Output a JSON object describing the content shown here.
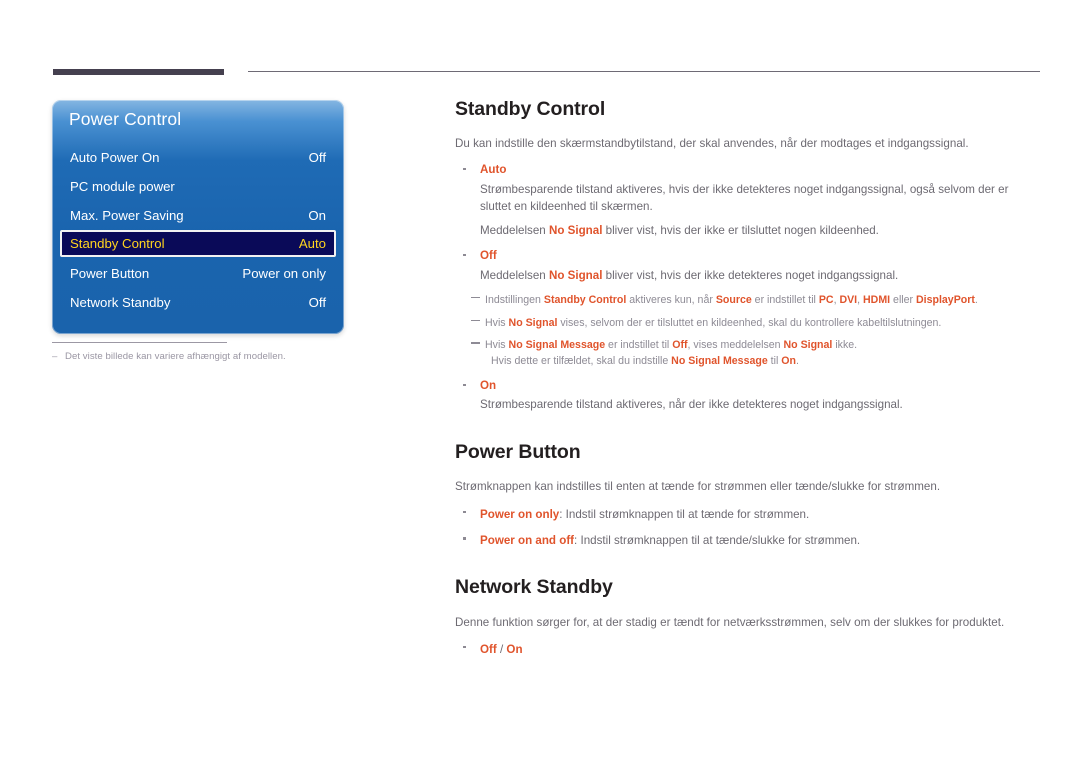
{
  "colors": {
    "accent": "#e0542c",
    "heading": "#231f20",
    "body": "#6d6a72",
    "note": "#8e8b95",
    "osd_selected_bg": "#0a0a58",
    "osd_selected_text": "#ffd41f",
    "top_bar": "#45404f"
  },
  "osd": {
    "title": "Power Control",
    "rows": [
      {
        "label": "Auto Power On",
        "value": "Off",
        "selected": false
      },
      {
        "label": "PC module power",
        "value": "",
        "selected": false
      },
      {
        "label": "Max. Power Saving",
        "value": "On",
        "selected": false
      },
      {
        "label": "Standby Control",
        "value": "Auto",
        "selected": true
      },
      {
        "label": "Power Button",
        "value": "Power on only",
        "selected": false
      },
      {
        "label": "Network Standby",
        "value": "Off",
        "selected": false
      }
    ],
    "footnote": "Det viste billede kan variere afhængigt af modellen.",
    "footnote_dash": "–"
  },
  "sections": {
    "standby_control": {
      "heading": "Standby Control",
      "lead": "Du kan indstille den skærmstandbytilstand, der skal anvendes, når der modtages et indgangssignal.",
      "items": [
        {
          "term": "Auto",
          "desc1": "Strømbesparende tilstand aktiveres, hvis der ikke detekteres noget indgangssignal, også selvom der er sluttet en kildeenhed til skærmen.",
          "desc2_pre": "Meddelelsen ",
          "desc2_b": "No Signal",
          "desc2_post": " bliver vist, hvis der ikke er tilsluttet nogen kildeenhed."
        },
        {
          "term": "Off",
          "desc1_pre": "Meddelelsen ",
          "desc1_b": "No Signal",
          "desc1_post": " bliver vist, hvis der ikke detekteres noget indgangssignal."
        },
        {
          "term": "On",
          "desc1": "Strømbesparende tilstand aktiveres, når der ikke detekteres noget indgangssignal."
        }
      ],
      "notes": [
        {
          "p1": "Indstillingen ",
          "b1": "Standby Control",
          "p2": " aktiveres kun, når ",
          "b2": "Source",
          "p3": " er indstillet til ",
          "b3": "PC",
          "p4": ", ",
          "b4": "DVI",
          "p5": ", ",
          "b5": "HDMI",
          "p6": " eller ",
          "b6": "DisplayPort",
          "p7": "."
        },
        {
          "p1": "Hvis ",
          "b1": "No Signal",
          "p2": " vises, selvom der er tilsluttet en kildeenhed, skal du kontrollere kabeltilslutningen."
        },
        {
          "p1": "Hvis ",
          "b1": "No Signal Message",
          "p2": " er indstillet til ",
          "b2": "Off",
          "p3": ", vises meddelelsen ",
          "b3": "No Signal",
          "p4": " ikke.",
          "c1": "Hvis dette er tilfældet, skal du indstille ",
          "cb1": "No Signal Message",
          "c2": " til ",
          "cb2": "On",
          "c3": "."
        }
      ]
    },
    "power_button": {
      "heading": "Power Button",
      "lead": "Strømknappen kan indstilles til enten at tænde for strømmen eller tænde/slukke for strømmen.",
      "items": [
        {
          "term": "Power on only",
          "desc": ": Indstil strømknappen til at tænde for strømmen."
        },
        {
          "term": "Power on and off",
          "desc": ": Indstil strømknappen til at tænde/slukke for strømmen."
        }
      ]
    },
    "network_standby": {
      "heading": "Network Standby",
      "lead": "Denne funktion sørger for, at der stadig er tændt for netværksstrømmen, selv om der slukkes for produktet.",
      "option_off": "Off",
      "option_sep": " / ",
      "option_on": "On"
    }
  }
}
